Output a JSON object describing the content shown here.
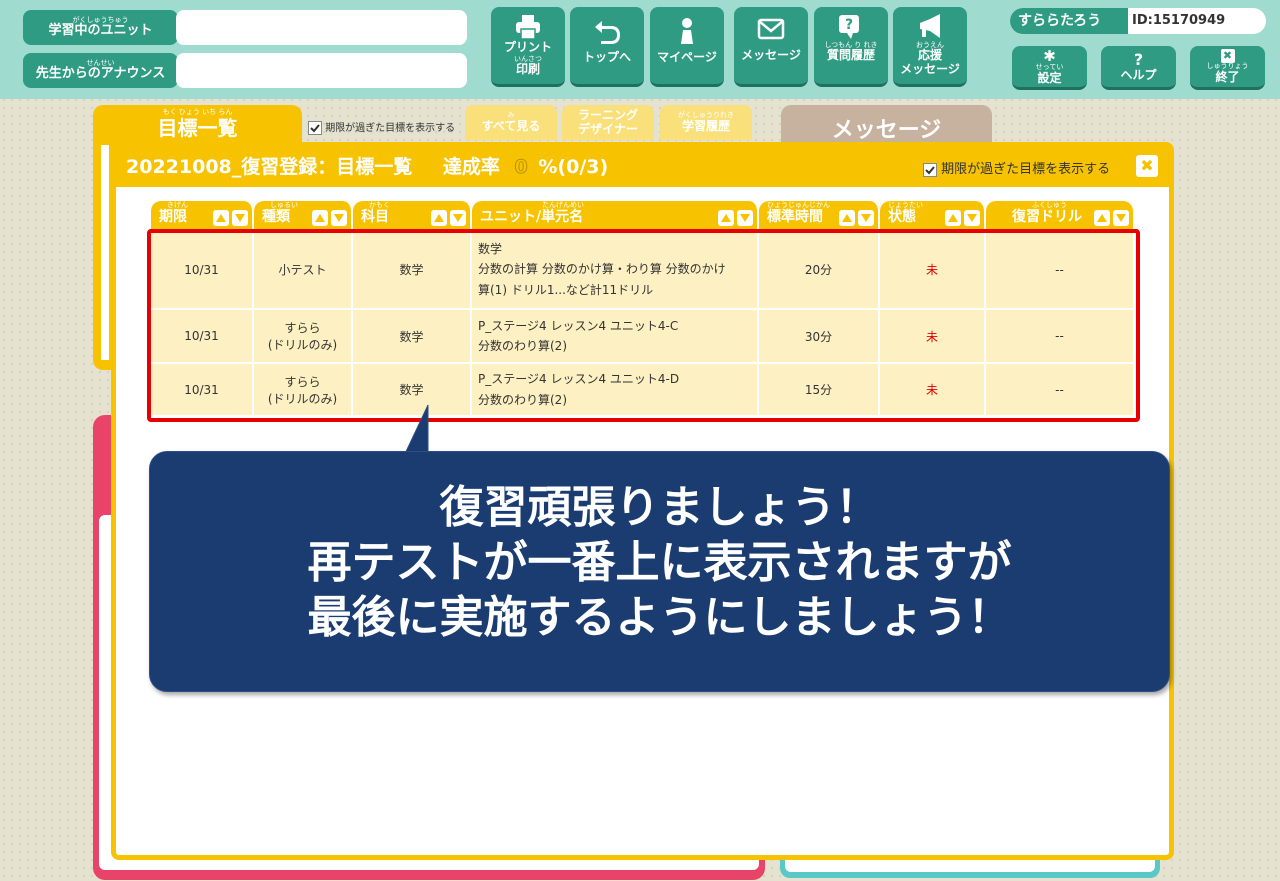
{
  "header": {
    "unit_label_ruby": "がくしゅうちゅう",
    "unit_label": "学習中のユニット",
    "announce_label_ruby": "せんせい",
    "announce_label": "先生からのアナウンス",
    "nav": [
      {
        "label": "プリント",
        "ruby": "いんさつ",
        "label2": "印刷",
        "icon": "printer-icon"
      },
      {
        "label": "トップへ",
        "icon": "return-arrow-icon"
      },
      {
        "label": "マイページ",
        "icon": "person-icon"
      },
      {
        "label": "メッセージ",
        "icon": "envelope-icon"
      },
      {
        "label": "質問履歴",
        "ruby": "しつもん り れき",
        "icon": "question-bubble-icon"
      },
      {
        "label": "応援",
        "ruby": "おうえん",
        "label2": "メッセージ",
        "icon": "megaphone-icon"
      }
    ],
    "user_name": "すららたろう",
    "user_id": "ID:15170949",
    "settings_ruby": "せってい",
    "settings": "設定",
    "help": "ヘルプ",
    "exit_ruby": "しゅうりょう",
    "exit": "終了"
  },
  "background": {
    "goal_tab_ruby": "もく ひょう いち らん",
    "goal_tab": "目標一覧",
    "show_expired": "期限が過ぎた目標を表示する",
    "see_all_ruby": "み",
    "see_all": "すべて見る",
    "learning_designer_1": "ラーニング",
    "learning_designer_2": "デザイナー",
    "history_ruby": "がくしゅうりれき",
    "history": "学習履歴",
    "message_tab": "メッセージ"
  },
  "modal": {
    "title": "20221008_復習登録：目標一覧",
    "rate_label": "達成率",
    "rate_value": "0",
    "rate_suffix": "%(0/3)",
    "show_expired": "期限が過ぎた目標を表示する",
    "columns": [
      {
        "label": "期限",
        "ruby": "きげん"
      },
      {
        "label": "種類",
        "ruby": "しゅるい"
      },
      {
        "label": "科目",
        "ruby": "かもく"
      },
      {
        "label": "ユニット/単元名",
        "ruby": "たんげんめい"
      },
      {
        "label": "標準時間",
        "ruby": "ひょうじゅんじかん"
      },
      {
        "label": "状態",
        "ruby": "じょうたい"
      },
      {
        "label": "復習ドリル",
        "ruby": "ふくしゅう"
      }
    ],
    "rows": [
      {
        "deadline": "10/31",
        "type": "小テスト",
        "type2": "",
        "subject": "数学",
        "unit": [
          "数学",
          "分数の計算 分数のかけ算・わり算 分数のかけ",
          "算(1) ドリル1...など計11ドリル"
        ],
        "time": "20分",
        "status": "未",
        "drill": "--"
      },
      {
        "deadline": "10/31",
        "type": "すらら",
        "type2": "(ドリルのみ)",
        "subject": "数学",
        "unit": [
          "P_ステージ4 レッスン4 ユニット4-C",
          "分数のわり算(2)"
        ],
        "time": "30分",
        "status": "未",
        "drill": "--"
      },
      {
        "deadline": "10/31",
        "type": "すらら",
        "type2": "(ドリルのみ)",
        "subject": "数学",
        "unit": [
          "P_ステージ4 レッスン4 ユニット4-D",
          "分数のわり算(2)"
        ],
        "time": "15分",
        "status": "未",
        "drill": "--"
      }
    ]
  },
  "callout": {
    "line1": "復習頑張りましょう！",
    "line2": "再テストが一番上に表示されますが",
    "line3": "最後に実施するようにしましょう！"
  },
  "colors": {
    "header_bg": "#9fdccf",
    "accent_green": "#2f9b82",
    "accent_yellow": "#f7c300",
    "callout_bg": "#1b3c70",
    "highlight_red": "#e60000"
  }
}
